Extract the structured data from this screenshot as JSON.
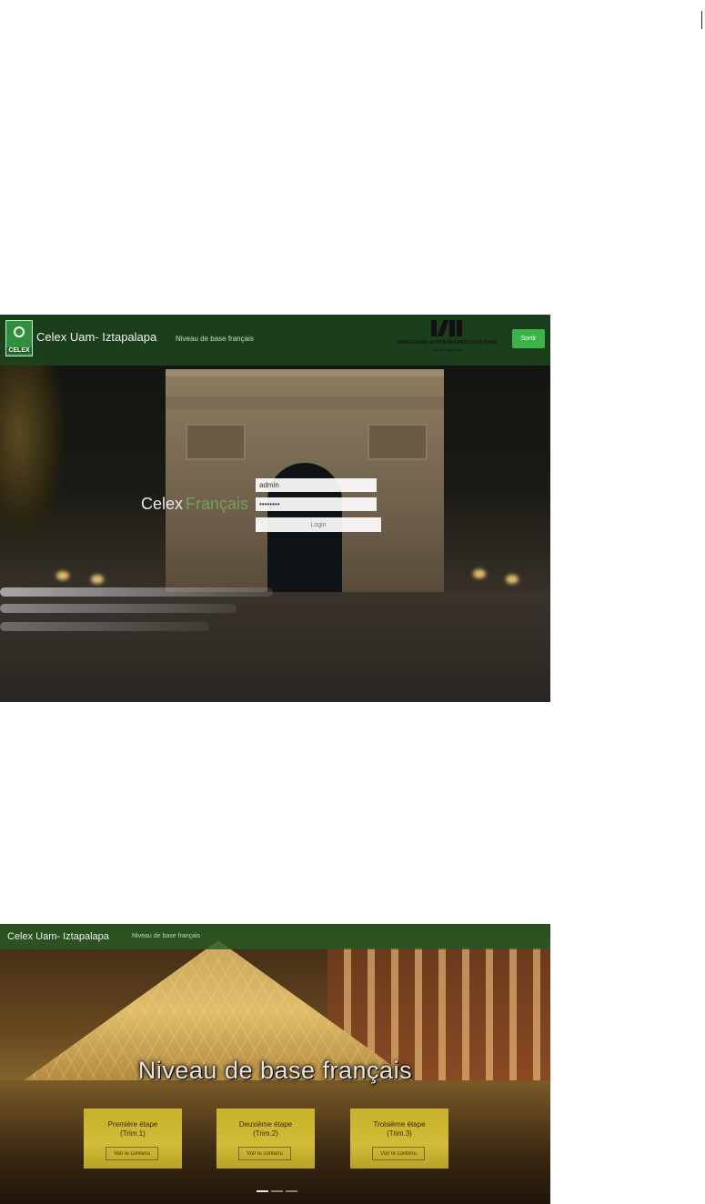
{
  "login_screen": {
    "header": {
      "logo_text": "CELEX",
      "brand": "Celex Uam- Iztapalapa",
      "subtitle": "Niveau de base français",
      "university_line1": "UNIVERSIDAD AUTÓNOMA METROPOLITANA",
      "university_line2": "Unidad Iztapalapa",
      "exit_button": "Sortir"
    },
    "hero_word_a": "Celex",
    "hero_word_b": "Français",
    "form": {
      "username_value": "admin",
      "password_value": "••••••••",
      "login_button": "Login"
    }
  },
  "course_screen": {
    "header": {
      "brand": "Celex Uam- Iztapalapa",
      "subtitle": "Niveau de base français"
    },
    "hero_title": "Niveau de base français",
    "stages": [
      {
        "title": "Première étape",
        "subtitle": "(Trim.1)",
        "button": "Voir le contenu"
      },
      {
        "title": "Deuxième étape",
        "subtitle": "(Trim.2)",
        "button": "Voir le contenu"
      },
      {
        "title": "Troisième étape",
        "subtitle": "(Trim.3)",
        "button": "Voir le contenu"
      }
    ],
    "carousel": {
      "slides": 3,
      "active": 1
    }
  },
  "colors": {
    "header_green": "#1c461e",
    "accent_green": "#3cb44a",
    "stage_card_yellow": "#d2bc38"
  }
}
